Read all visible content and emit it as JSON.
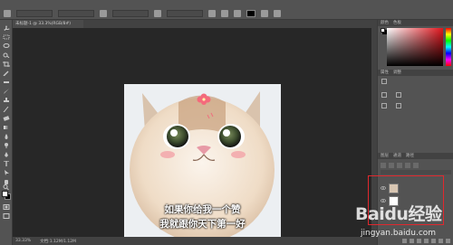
{
  "document": {
    "tab_title": "未标题-1 @ 33.3%(RGB/8#)",
    "zoom": "33.33%",
    "doc_info": "文档:1.12M/1.12M"
  },
  "artwork": {
    "caption_line1": "如果你给我一个赞",
    "caption_line2": "我就跟你天下第一好"
  },
  "panels": {
    "color_tabs": [
      "颜色",
      "色板"
    ],
    "adjust_tabs": [
      "属性",
      "调整"
    ],
    "layers_tabs": [
      "图层",
      "通道",
      "路径"
    ]
  },
  "colors": {
    "foreground": "#ffffff",
    "background": "#000000",
    "highlight_box": "#e0282e",
    "app_bg": "#535353",
    "canvas_bg": "#272727"
  },
  "watermark": {
    "brand": "Baidu经验",
    "url": "jingyan.baidu.com"
  }
}
